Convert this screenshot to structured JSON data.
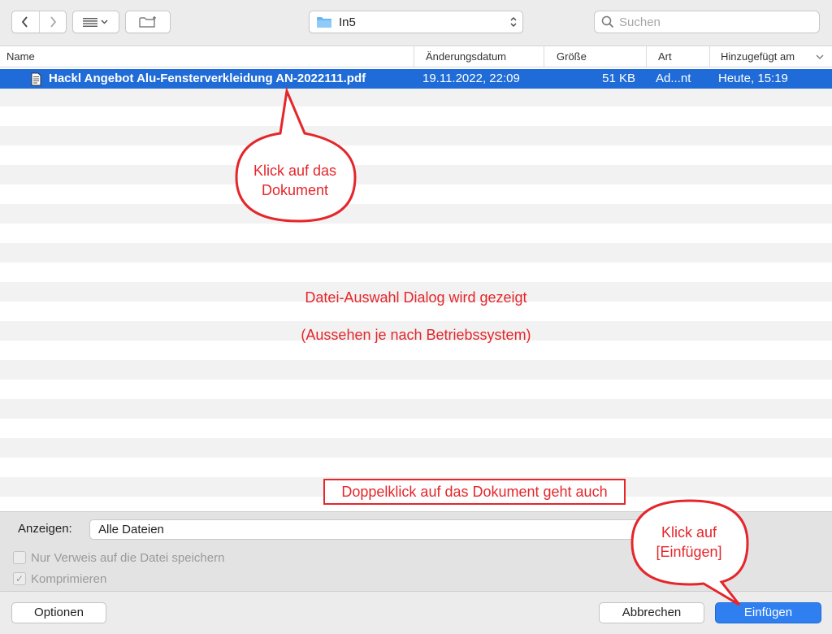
{
  "toolbar": {
    "location": "In5",
    "search_placeholder": "Suchen"
  },
  "columns": {
    "name": "Name",
    "modified": "Änderungsdatum",
    "size": "Größe",
    "kind": "Art",
    "added": "Hinzugefügt am"
  },
  "files": [
    {
      "name": "Hackl Angebot Alu-Fensterverkleidung AN-2022111.pdf",
      "modified": "19.11.2022, 22:09",
      "size": "51 KB",
      "kind": "Ad...nt",
      "added": "Heute, 15:19",
      "selected": true
    }
  ],
  "annotations": {
    "bubble_click": "Klick auf das Dokument",
    "dialog_line1": "Datei-Auswahl Dialog wird gezeigt",
    "dialog_line2": "(Aussehen je nach Betriebssystem)",
    "double_click": "Doppelklick auf das Dokument geht auch",
    "bubble_insert": "Klick auf [Einfügen]"
  },
  "options": {
    "show_label": "Anzeigen:",
    "show_value": "Alle Dateien",
    "checkbox_reference": "Nur Verweis auf die Datei speichern",
    "checkbox_reference_checked": false,
    "checkbox_compress": "Komprimieren",
    "checkbox_compress_checked": true
  },
  "buttons": {
    "options": "Optionen",
    "cancel": "Abbrechen",
    "insert": "Einfügen"
  },
  "colors": {
    "selection": "#1f6bd7",
    "annotation_red": "#e5262b",
    "primary_button": "#2f7ff0"
  }
}
